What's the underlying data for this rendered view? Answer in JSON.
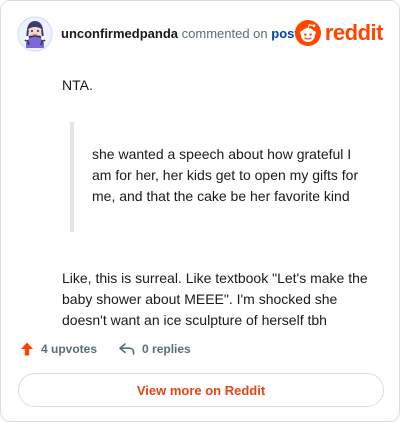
{
  "header": {
    "username": "unconfirmedpanda",
    "action_text": "commented on",
    "post_link": "post",
    "logo_text": "reddit"
  },
  "comment": {
    "intro": "NTA.",
    "quote": "she wanted a speech about how grateful I am for her, her kids get to open my gifts for me, and that the cake be her favorite kind",
    "body": "Like, this is surreal. Like textbook \"Let's make the baby shower about MEEE\". I'm shocked she doesn't want an ice sculpture of herself tbh"
  },
  "actions": {
    "upvotes": "4 upvotes",
    "replies": "0 replies"
  },
  "footer": {
    "view_more": "View more on Reddit"
  },
  "colors": {
    "brand": "#FF4500",
    "link": "#0045AC",
    "muted": "#576F76",
    "border": "#D9DDE2"
  },
  "icons": {
    "avatar": "user-avatar",
    "logo": "reddit-logo-icon",
    "upvote": "upvote-arrow-icon",
    "reply": "reply-arrow-icon"
  }
}
